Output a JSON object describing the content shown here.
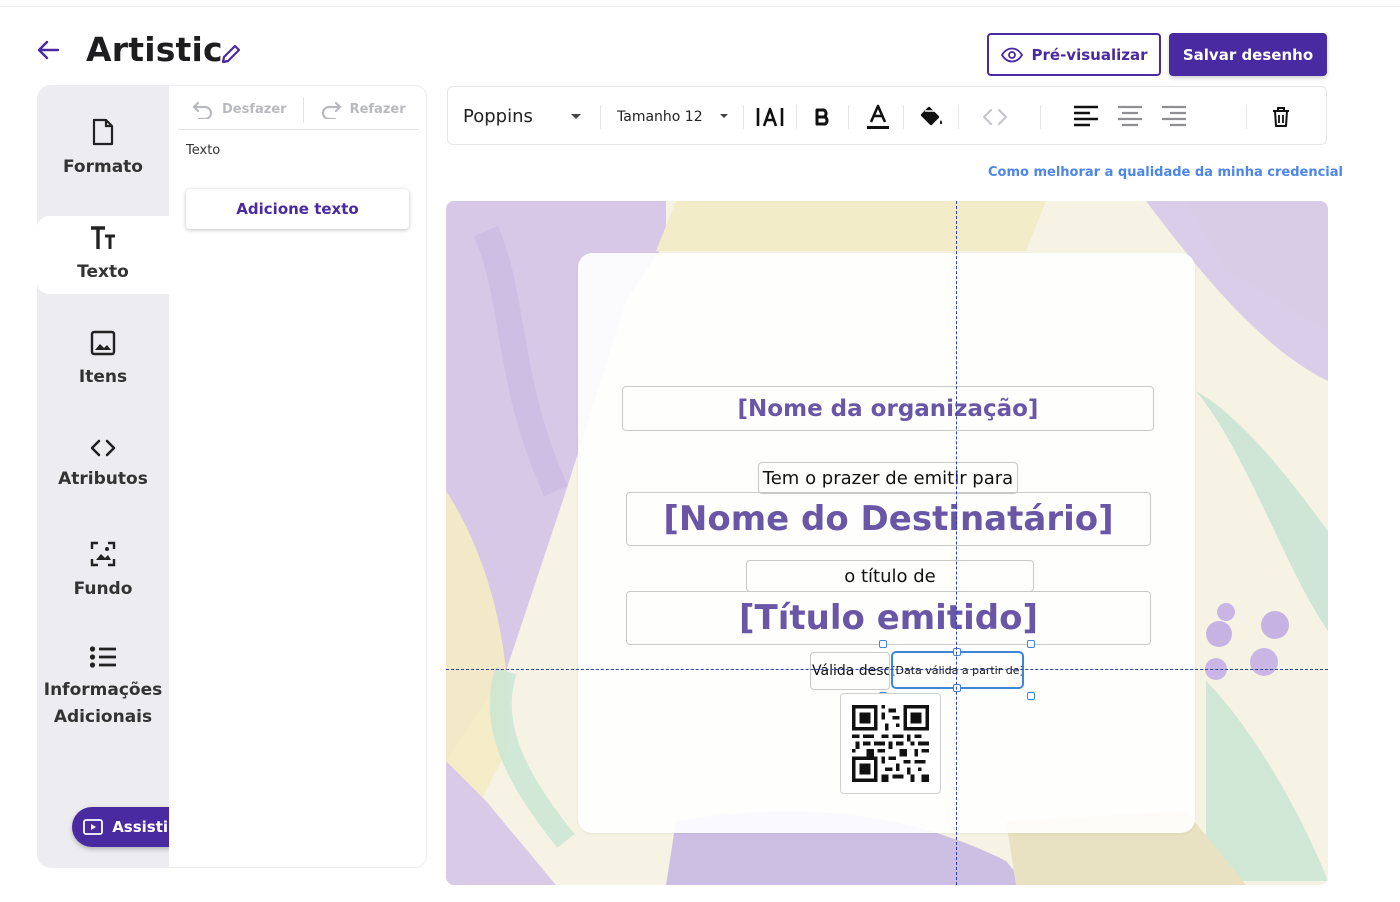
{
  "header": {
    "title": "Artistic",
    "preview_label": "Pré-visualizar",
    "save_label": "Salvar desenho"
  },
  "sidebar": {
    "items": [
      {
        "label": "Formato",
        "icon": "document-icon"
      },
      {
        "label": "Texto",
        "icon": "text-size-icon"
      },
      {
        "label": "Itens",
        "icon": "image-icon"
      },
      {
        "label": "Atributos",
        "icon": "code-icon"
      },
      {
        "label": "Fundo",
        "icon": "background-icon"
      },
      {
        "label": "Informações Adicionais",
        "icon": "list-icon"
      }
    ],
    "active": "Texto",
    "video_label": "Assistir vídeo"
  },
  "panel": {
    "undo_label": "Desfazer",
    "redo_label": "Refazer",
    "section_label": "Texto",
    "add_text_label": "Adicione texto"
  },
  "toolbar": {
    "font": "Poppins",
    "size": "Tamanho 12"
  },
  "help_link": "Como melhorar a qualidade da minha credencial",
  "certificate": {
    "org_name": "[Nome da organização]",
    "intro": "Tem o prazer de emitir para",
    "recipient": "[Nome do Destinatário]",
    "title_intro": "o título de",
    "issued_title": "[Título emitido]",
    "valid_from_label": "Válida desde",
    "valid_from_value": "[Data válida a partir de]"
  },
  "colors": {
    "accent": "#4a2aa0",
    "link": "#4d86e6",
    "placeholder_text": "#6a56a6",
    "selection": "#3b86d8",
    "guide": "#2c3fb8"
  }
}
